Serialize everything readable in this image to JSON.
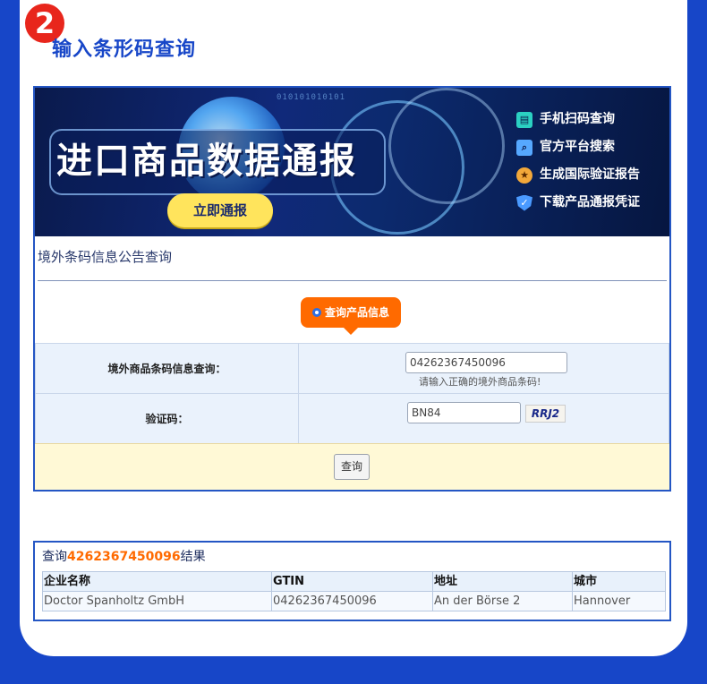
{
  "step": {
    "number": "2",
    "title": "输入条形码查询"
  },
  "banner": {
    "headline": "进口商品数据通报",
    "binary": "010101010101",
    "cta_label": "立即通报",
    "features": [
      {
        "icon": "phone-scan-icon",
        "label": "手机扫码查询"
      },
      {
        "icon": "search-icon",
        "label": "官方平台搜索"
      },
      {
        "icon": "medal-icon",
        "label": "生成国际验证报告"
      },
      {
        "icon": "shield-icon",
        "label": "下载产品通报凭证"
      }
    ]
  },
  "query": {
    "section_title": "境外条码信息公告查询",
    "tag_label": "查询产品信息",
    "barcode_label": "境外商品条码信息查询：",
    "barcode_value": "04262367450096",
    "barcode_hint": "请输入正确的境外商品条码!",
    "captcha_label": "验证码：",
    "captcha_value": "BN84",
    "captcha_image_text": "RRJ2",
    "submit_label": "查询"
  },
  "result": {
    "title_prefix": "查询",
    "title_code": "4262367450096",
    "title_suffix": "结果",
    "columns": [
      "企业名称",
      "GTIN",
      "地址",
      "城市"
    ],
    "rows": [
      [
        "Doctor Spanholtz GmbH",
        "04262367450096",
        "An der Börse 2",
        "Hannover"
      ]
    ]
  },
  "colors": {
    "brand_blue": "#1746c8",
    "accent_orange": "#ff6a00",
    "badge_red": "#e8261c",
    "cta_yellow": "#ffe45c"
  }
}
